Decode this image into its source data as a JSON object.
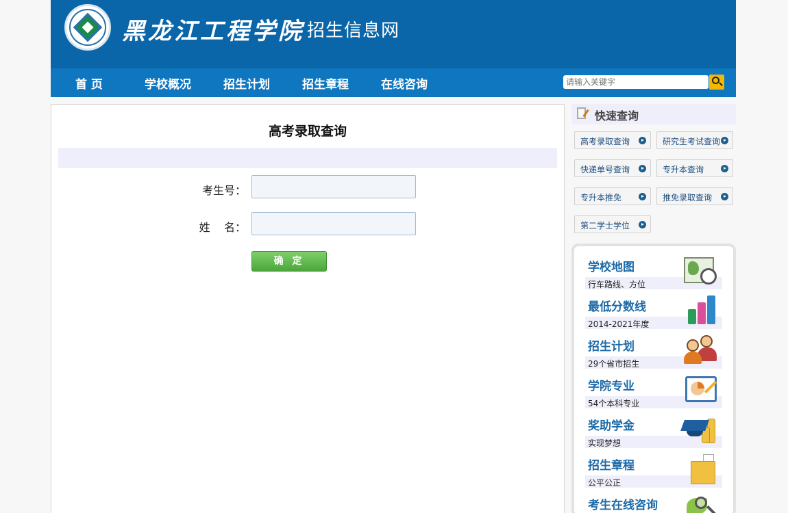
{
  "header": {
    "school_name": "黑龙江工程学院",
    "site_name": "招生信息网"
  },
  "nav": {
    "items": [
      {
        "label": "首 页"
      },
      {
        "label": "学校概况"
      },
      {
        "label": "招生计划"
      },
      {
        "label": "招生章程"
      },
      {
        "label": "在线咨询"
      }
    ],
    "search": {
      "placeholder": "请输入关键字"
    }
  },
  "main": {
    "title": "高考录取查询",
    "form": {
      "exam_number_label": "考生号：",
      "exam_number_value": "",
      "name_label": "姓    名：",
      "name_value": "",
      "confirm_label": "确 定"
    }
  },
  "sidebar": {
    "quick_search": {
      "title": "快速查询",
      "buttons": [
        {
          "label": "高考录取查询"
        },
        {
          "label": "研究生考试查询"
        },
        {
          "label": "快递单号查询"
        },
        {
          "label": "专升本查询"
        },
        {
          "label": "专升本推免"
        },
        {
          "label": "推免录取查询"
        },
        {
          "label": "第二学士学位"
        }
      ]
    },
    "links": [
      {
        "title": "学校地图",
        "subtitle": "行车路线、方位",
        "icon": "map-compass-icon"
      },
      {
        "title": "最低分数线",
        "subtitle": "2014-2021年度",
        "icon": "bar-chart-icon"
      },
      {
        "title": "招生计划",
        "subtitle": "29个省市招生",
        "icon": "people-icon"
      },
      {
        "title": "学院专业",
        "subtitle": "54个本科专业",
        "icon": "presentation-board-icon"
      },
      {
        "title": "奖助学金",
        "subtitle": "实现梦想",
        "icon": "graduation-cap-coins-icon"
      },
      {
        "title": "招生章程",
        "subtitle": "公平公正",
        "icon": "folder-icon"
      },
      {
        "title": "考生在线咨询",
        "subtitle": "",
        "icon": "magnifier-icon"
      }
    ]
  },
  "colors": {
    "header_blue": "#0a66a8",
    "nav_blue": "#0f77c0",
    "link_blue": "#1c6aa8",
    "confirm_green": "#5cb848",
    "search_yellow": "#f5b800"
  }
}
